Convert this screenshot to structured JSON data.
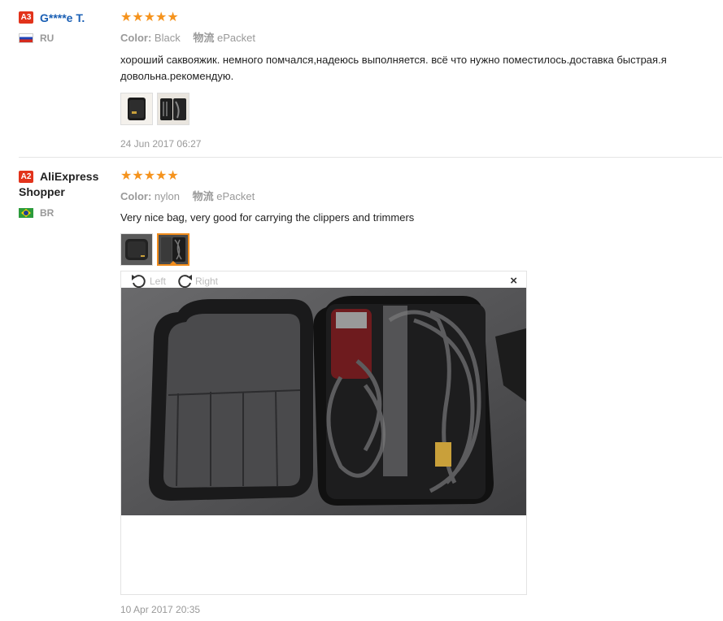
{
  "reviews": [
    {
      "badge": "A3",
      "user_name": "G****e T.",
      "country": "RU",
      "stars": "★★★★★",
      "color_label": "Color:",
      "color_value": "Black",
      "shipping_label": "物流",
      "shipping_value": "ePacket",
      "text": "хороший саквояжик. немного помчался,надеюсь выполняется. всё что нужно поместилось.доставка быстрая.я довольна.рекомендую.",
      "date": "24 Jun 2017 06:27"
    },
    {
      "badge": "A2",
      "user_name": "AliExpress Shopper",
      "country": "BR",
      "stars": "★★★★★",
      "color_label": "Color:",
      "color_value": "nylon",
      "shipping_label": "物流",
      "shipping_value": "ePacket",
      "text": "Very nice bag, very good for carrying the clippers and trimmers",
      "date": "10 Apr 2017 20:35"
    }
  ],
  "viewer": {
    "rotate_left_label": "Left",
    "rotate_right_label": "Right",
    "close_label": "×"
  },
  "icons": [
    "rotate-left-icon",
    "rotate-right-icon",
    "close-icon",
    "star-icon",
    "flag-ru-icon",
    "flag-br-icon"
  ],
  "colors": {
    "star": "#f5931d",
    "badge": "#e2331b",
    "link": "#1a5fb4",
    "active_thumb": "#f08c1c"
  }
}
